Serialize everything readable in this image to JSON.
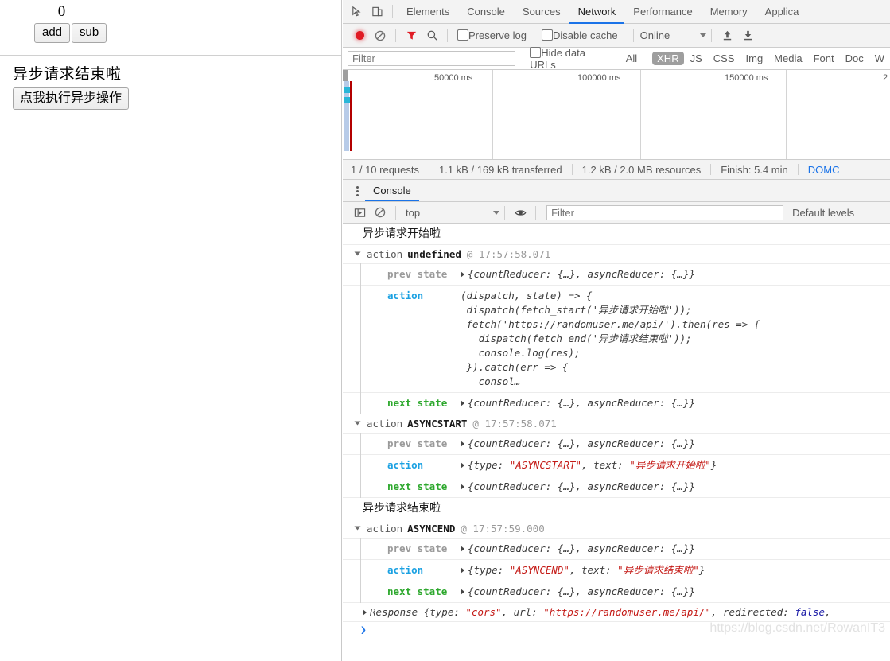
{
  "page": {
    "counter_value": "0",
    "add_label": "add",
    "sub_label": "sub",
    "async_status_text": "异步请求结束啦",
    "async_button_label": "点我执行异步操作"
  },
  "devtools": {
    "main_tabs": [
      {
        "label": "Elements",
        "active": false
      },
      {
        "label": "Console",
        "active": false
      },
      {
        "label": "Sources",
        "active": false
      },
      {
        "label": "Network",
        "active": true
      },
      {
        "label": "Performance",
        "active": false
      },
      {
        "label": "Memory",
        "active": false
      },
      {
        "label": "Applica",
        "active": false
      }
    ],
    "network_toolbar": {
      "preserve_log_label": "Preserve log",
      "preserve_log_checked": false,
      "disable_cache_label": "Disable cache",
      "disable_cache_checked": false,
      "throttling_value": "Online"
    },
    "network_filterbar": {
      "filter_placeholder": "Filter",
      "filter_value": "",
      "hide_data_urls_label": "Hide data URLs",
      "hide_data_urls_checked": false,
      "types": [
        {
          "label": "All",
          "selected": false
        },
        {
          "label": "XHR",
          "selected": true
        },
        {
          "label": "JS",
          "selected": false
        },
        {
          "label": "CSS",
          "selected": false
        },
        {
          "label": "Img",
          "selected": false
        },
        {
          "label": "Media",
          "selected": false
        },
        {
          "label": "Font",
          "selected": false
        },
        {
          "label": "Doc",
          "selected": false
        },
        {
          "label": "W",
          "selected": false
        }
      ]
    },
    "waterfall": {
      "ticks": [
        "50000 ms",
        "100000 ms",
        "150000 ms",
        "2"
      ]
    },
    "network_status": {
      "requests": "1 / 10 requests",
      "transferred": "1.1 kB / 169 kB transferred",
      "resources": "1.2 kB / 2.0 MB resources",
      "finish": "Finish: 5.4 min",
      "domcontent": "DOMC"
    },
    "drawer": {
      "tab_label": "Console",
      "context_value": "top",
      "filter_placeholder": "Filter",
      "filter_value": "",
      "levels_label": "Default levels"
    },
    "console_log": {
      "entries": [
        {
          "kind": "plain",
          "text": "异步请求开始啦"
        },
        {
          "kind": "group",
          "word": "action",
          "name": "undefined",
          "at": "@ 17:57:58.071",
          "rows": [
            {
              "label": "prev state",
              "label_kind": "prev",
              "expandable": true,
              "value": "{countReducer: {…}, asyncReducer: {…}}"
            },
            {
              "label": "action",
              "label_kind": "action",
              "expandable": false,
              "code": "(dispatch, state) => {\n dispatch(fetch_start('异步请求开始啦'));\n fetch('https://randomuser.me/api/').then(res => {\n   dispatch(fetch_end('异步请求结束啦'));\n   console.log(res);\n }).catch(err => {\n   consol…"
            },
            {
              "label": "next state",
              "label_kind": "next",
              "expandable": true,
              "value": "{countReducer: {…}, asyncReducer: {…}}"
            }
          ]
        },
        {
          "kind": "group",
          "word": "action",
          "name": "ASYNCSTART",
          "at": "@ 17:57:58.071",
          "rows": [
            {
              "label": "prev state",
              "label_kind": "prev",
              "expandable": true,
              "value": "{countReducer: {…}, asyncReducer: {…}}"
            },
            {
              "label": "action",
              "label_kind": "action",
              "expandable": true,
              "parts": [
                {
                  "t": "{type: ",
                  "c": "plain"
                },
                {
                  "t": "\"ASYNCSTART\"",
                  "c": "red"
                },
                {
                  "t": ", text: ",
                  "c": "plain"
                },
                {
                  "t": "\"异步请求开始啦\"",
                  "c": "red"
                },
                {
                  "t": "}",
                  "c": "plain"
                }
              ]
            },
            {
              "label": "next state",
              "label_kind": "next",
              "expandable": true,
              "value": "{countReducer: {…}, asyncReducer: {…}}"
            }
          ]
        },
        {
          "kind": "plain",
          "text": "异步请求结束啦"
        },
        {
          "kind": "group",
          "word": "action",
          "name": "ASYNCEND",
          "at": "@ 17:57:59.000",
          "rows": [
            {
              "label": "prev state",
              "label_kind": "prev",
              "expandable": true,
              "value": "{countReducer: {…}, asyncReducer: {…}}"
            },
            {
              "label": "action",
              "label_kind": "action",
              "expandable": true,
              "parts": [
                {
                  "t": "{type: ",
                  "c": "plain"
                },
                {
                  "t": "\"ASYNCEND\"",
                  "c": "red"
                },
                {
                  "t": ", text: ",
                  "c": "plain"
                },
                {
                  "t": "\"异步请求结束啦\"",
                  "c": "red"
                },
                {
                  "t": "}",
                  "c": "plain"
                }
              ]
            },
            {
              "label": "next state",
              "label_kind": "next",
              "expandable": true,
              "value": "{countReducer: {…}, asyncReducer: {…}}"
            }
          ]
        },
        {
          "kind": "response",
          "parts": [
            {
              "t": "Response {type: ",
              "c": "plain"
            },
            {
              "t": "\"cors\"",
              "c": "red"
            },
            {
              "t": ", url: ",
              "c": "plain"
            },
            {
              "t": "\"https://randomuser.me/api/\"",
              "c": "red"
            },
            {
              "t": ", redirected: ",
              "c": "plain"
            },
            {
              "t": "false",
              "c": "blue"
            },
            {
              "t": ",",
              "c": "plain"
            }
          ]
        }
      ],
      "prompt_symbol": "❯"
    },
    "watermark": "https://blog.csdn.net/RowanIT3"
  },
  "colors": {
    "accent": "#1a73e8",
    "record_red": "#e01b24",
    "string_red": "#c41a16",
    "label_action": "#1ba1e2",
    "label_next": "#2ea82e",
    "selected_chip": "#9e9e9e"
  }
}
